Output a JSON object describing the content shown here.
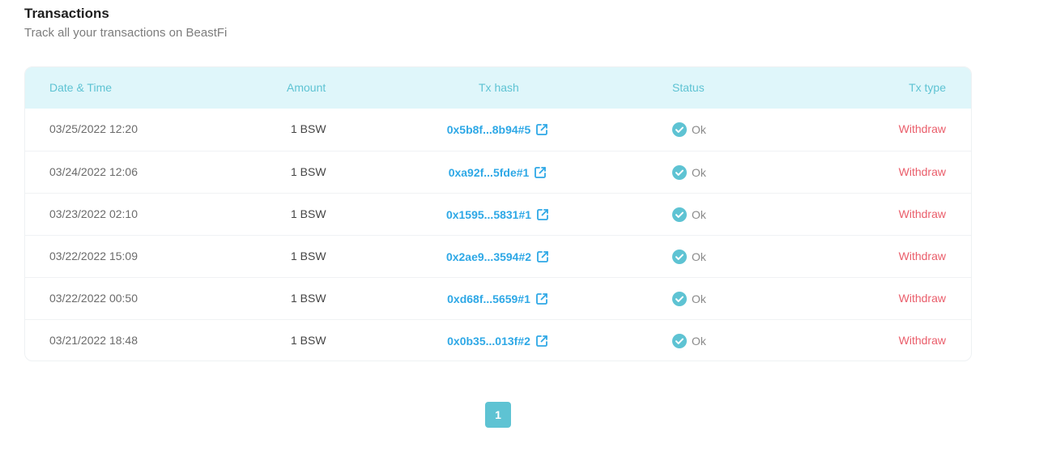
{
  "header": {
    "title": "Transactions",
    "subtitle": "Track all your transactions on BeastFi"
  },
  "table": {
    "columns": {
      "date": "Date & Time",
      "amount": "Amount",
      "hash": "Tx hash",
      "status": "Status",
      "type": "Tx type"
    },
    "rows": [
      {
        "date": "03/25/2022 12:20",
        "amount": "1 BSW",
        "hash": "0x5b8f...8b94#5",
        "status": "Ok",
        "type": "Withdraw"
      },
      {
        "date": "03/24/2022 12:06",
        "amount": "1 BSW",
        "hash": "0xa92f...5fde#1",
        "status": "Ok",
        "type": "Withdraw"
      },
      {
        "date": "03/23/2022 02:10",
        "amount": "1 BSW",
        "hash": "0x1595...5831#1",
        "status": "Ok",
        "type": "Withdraw"
      },
      {
        "date": "03/22/2022 15:09",
        "amount": "1 BSW",
        "hash": "0x2ae9...3594#2",
        "status": "Ok",
        "type": "Withdraw"
      },
      {
        "date": "03/22/2022 00:50",
        "amount": "1 BSW",
        "hash": "0xd68f...5659#1",
        "status": "Ok",
        "type": "Withdraw"
      },
      {
        "date": "03/21/2022 18:48",
        "amount": "1 BSW",
        "hash": "0x0b35...013f#2",
        "status": "Ok",
        "type": "Withdraw"
      }
    ]
  },
  "pagination": {
    "current_page": "1"
  },
  "colors": {
    "accent": "#5ec3d3",
    "header_bg": "#dff6fa",
    "hash_link": "#2ea8e6",
    "withdraw": "#ea5d6a"
  },
  "icons": {
    "status_ok": "check-circle-icon",
    "hash_link": "external-link-icon"
  }
}
